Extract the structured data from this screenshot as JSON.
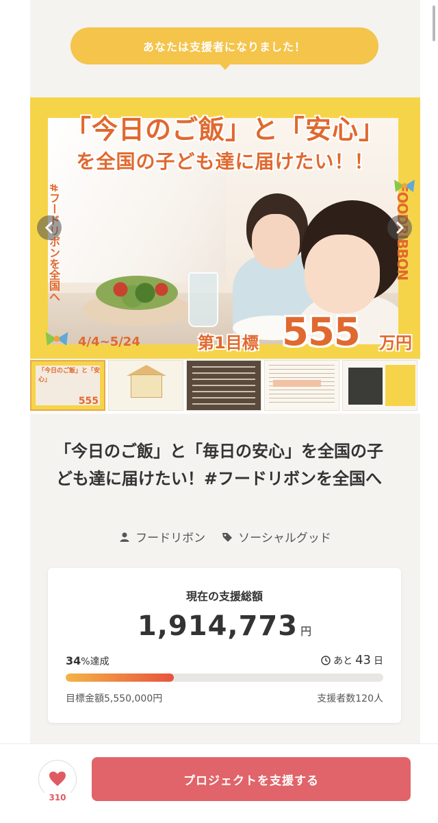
{
  "banner": {
    "text": "あなたは支援者になりました！"
  },
  "hero": {
    "title_line1": "「今日のご飯」と「安心」",
    "title_line2": "を全国の子ども達に届けたい！！",
    "side_left": "#フードリボンを全国へ",
    "side_right": "FOODRIBBON",
    "dates": "4/4~5/24",
    "goal_label": "第1目標",
    "goal_number": "555",
    "goal_unit": "万円",
    "prev_icon": "chevron-left-icon",
    "next_icon": "chevron-right-icon"
  },
  "thumbnails": [
    {
      "label": "「今日のご飯」と「安心」",
      "num": "555"
    },
    {
      "label": ""
    },
    {
      "label": ""
    },
    {
      "label": ""
    },
    {
      "label": ""
    }
  ],
  "project": {
    "title": "「今日のご飯」と「毎日の安心」を全国の子ども達に届けたい！#フードリボンを全国へ",
    "owner": "フードリボン",
    "category": "ソーシャルグッド"
  },
  "stats": {
    "label": "現在の支援総額",
    "amount": "1,914,773",
    "amount_unit": "円",
    "percent": "34",
    "percent_suffix": "%達成",
    "days_prefix": "あと",
    "days": "43",
    "days_unit": "日",
    "progress_fraction": 0.34,
    "goal_text": "目標金額5,550,000円",
    "supporters_text": "支援者数120人"
  },
  "footer": {
    "favorite_count": "310",
    "support_button": "プロジェクトを支援する"
  },
  "colors": {
    "accent": "#e0646a",
    "brand_yellow": "#f4c44b",
    "brand_orange": "#e0692f"
  }
}
